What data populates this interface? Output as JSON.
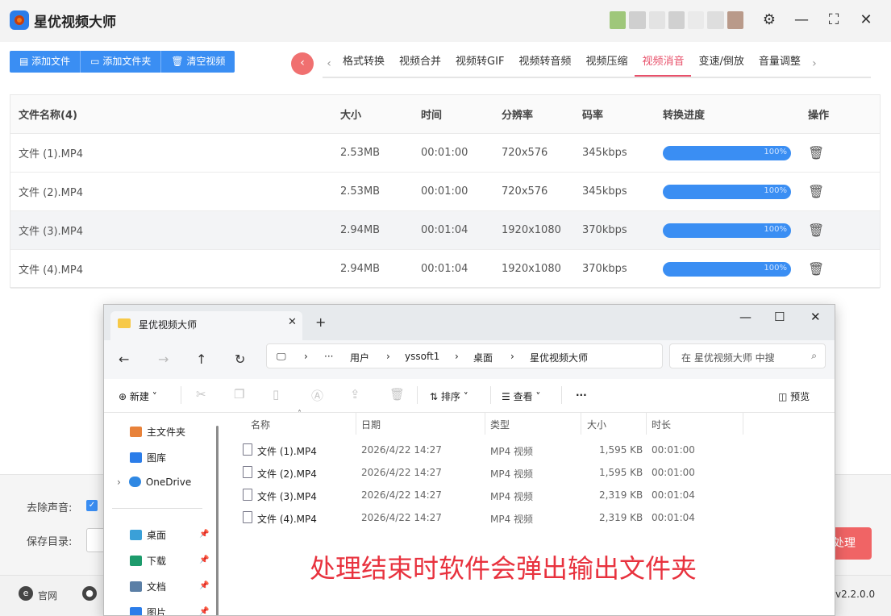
{
  "app": {
    "title": "星优视频大师",
    "toolbar": {
      "add_file": "添加文件",
      "add_folder": "添加文件夹",
      "clear_video": "清空视频"
    },
    "tabs": [
      "格式转换",
      "视频合并",
      "视频转GIF",
      "视频转音频",
      "视频压缩",
      "视频消音",
      "变速/倒放",
      "音量调整"
    ],
    "active_tab": "视频消音",
    "table": {
      "headers": [
        "文件名称(4)",
        "大小",
        "时间",
        "分辨率",
        "码率",
        "转换进度",
        "操作"
      ],
      "rows": [
        {
          "name": "文件 (1).MP4",
          "size": "2.53MB",
          "time": "00:01:00",
          "resolution": "720x576",
          "bitrate": "345kbps",
          "progress": "100%"
        },
        {
          "name": "文件 (2).MP4",
          "size": "2.53MB",
          "time": "00:01:00",
          "resolution": "720x576",
          "bitrate": "345kbps",
          "progress": "100%"
        },
        {
          "name": "文件 (3).MP4",
          "size": "2.94MB",
          "time": "00:01:04",
          "resolution": "1920x1080",
          "bitrate": "370kbps",
          "progress": "100%"
        },
        {
          "name": "文件 (4).MP4",
          "size": "2.94MB",
          "time": "00:01:04",
          "resolution": "1920x1080",
          "bitrate": "370kbps",
          "progress": "100%"
        }
      ]
    },
    "options": {
      "remove_sound_label": "去除声音:",
      "save_dir_label": "保存目录:"
    },
    "process_button": "处理",
    "footer": {
      "website": "官网",
      "version": "v2.2.0.0"
    }
  },
  "explorer": {
    "tab_title": "星优视频大师",
    "breadcrumb": [
      "···",
      "用户",
      "yssoft1",
      "桌面",
      "星优视频大师"
    ],
    "search_placeholder": "在 星优视频大师 中搜",
    "commands": {
      "new": "新建",
      "sort": "排序",
      "view": "查看",
      "more": "···",
      "preview": "预览"
    },
    "sidebar": {
      "home": "主文件夹",
      "gallery": "图库",
      "onedrive": "OneDrive",
      "desktop": "桌面",
      "downloads": "下载",
      "documents": "文档",
      "pictures": "图片"
    },
    "columns": [
      "名称",
      "日期",
      "类型",
      "大小",
      "时长"
    ],
    "files": [
      {
        "name": "文件 (1).MP4",
        "date": "2026/4/22 14:27",
        "type": "MP4 视频",
        "size": "1,595 KB",
        "duration": "00:01:00"
      },
      {
        "name": "文件 (2).MP4",
        "date": "2026/4/22 14:27",
        "type": "MP4 视频",
        "size": "1,595 KB",
        "duration": "00:01:00"
      },
      {
        "name": "文件 (3).MP4",
        "date": "2026/4/22 14:27",
        "type": "MP4 视频",
        "size": "2,319 KB",
        "duration": "00:01:04"
      },
      {
        "name": "文件 (4).MP4",
        "date": "2026/4/22 14:27",
        "type": "MP4 视频",
        "size": "2,319 KB",
        "duration": "00:01:04"
      }
    ]
  },
  "annotation": "处理结束时软件会弹出输出文件夹",
  "colors": {
    "accent": "#3a8ef3",
    "active_tab": "#e8506a",
    "annotation": "#e8323e",
    "process_button": "#f06465"
  }
}
